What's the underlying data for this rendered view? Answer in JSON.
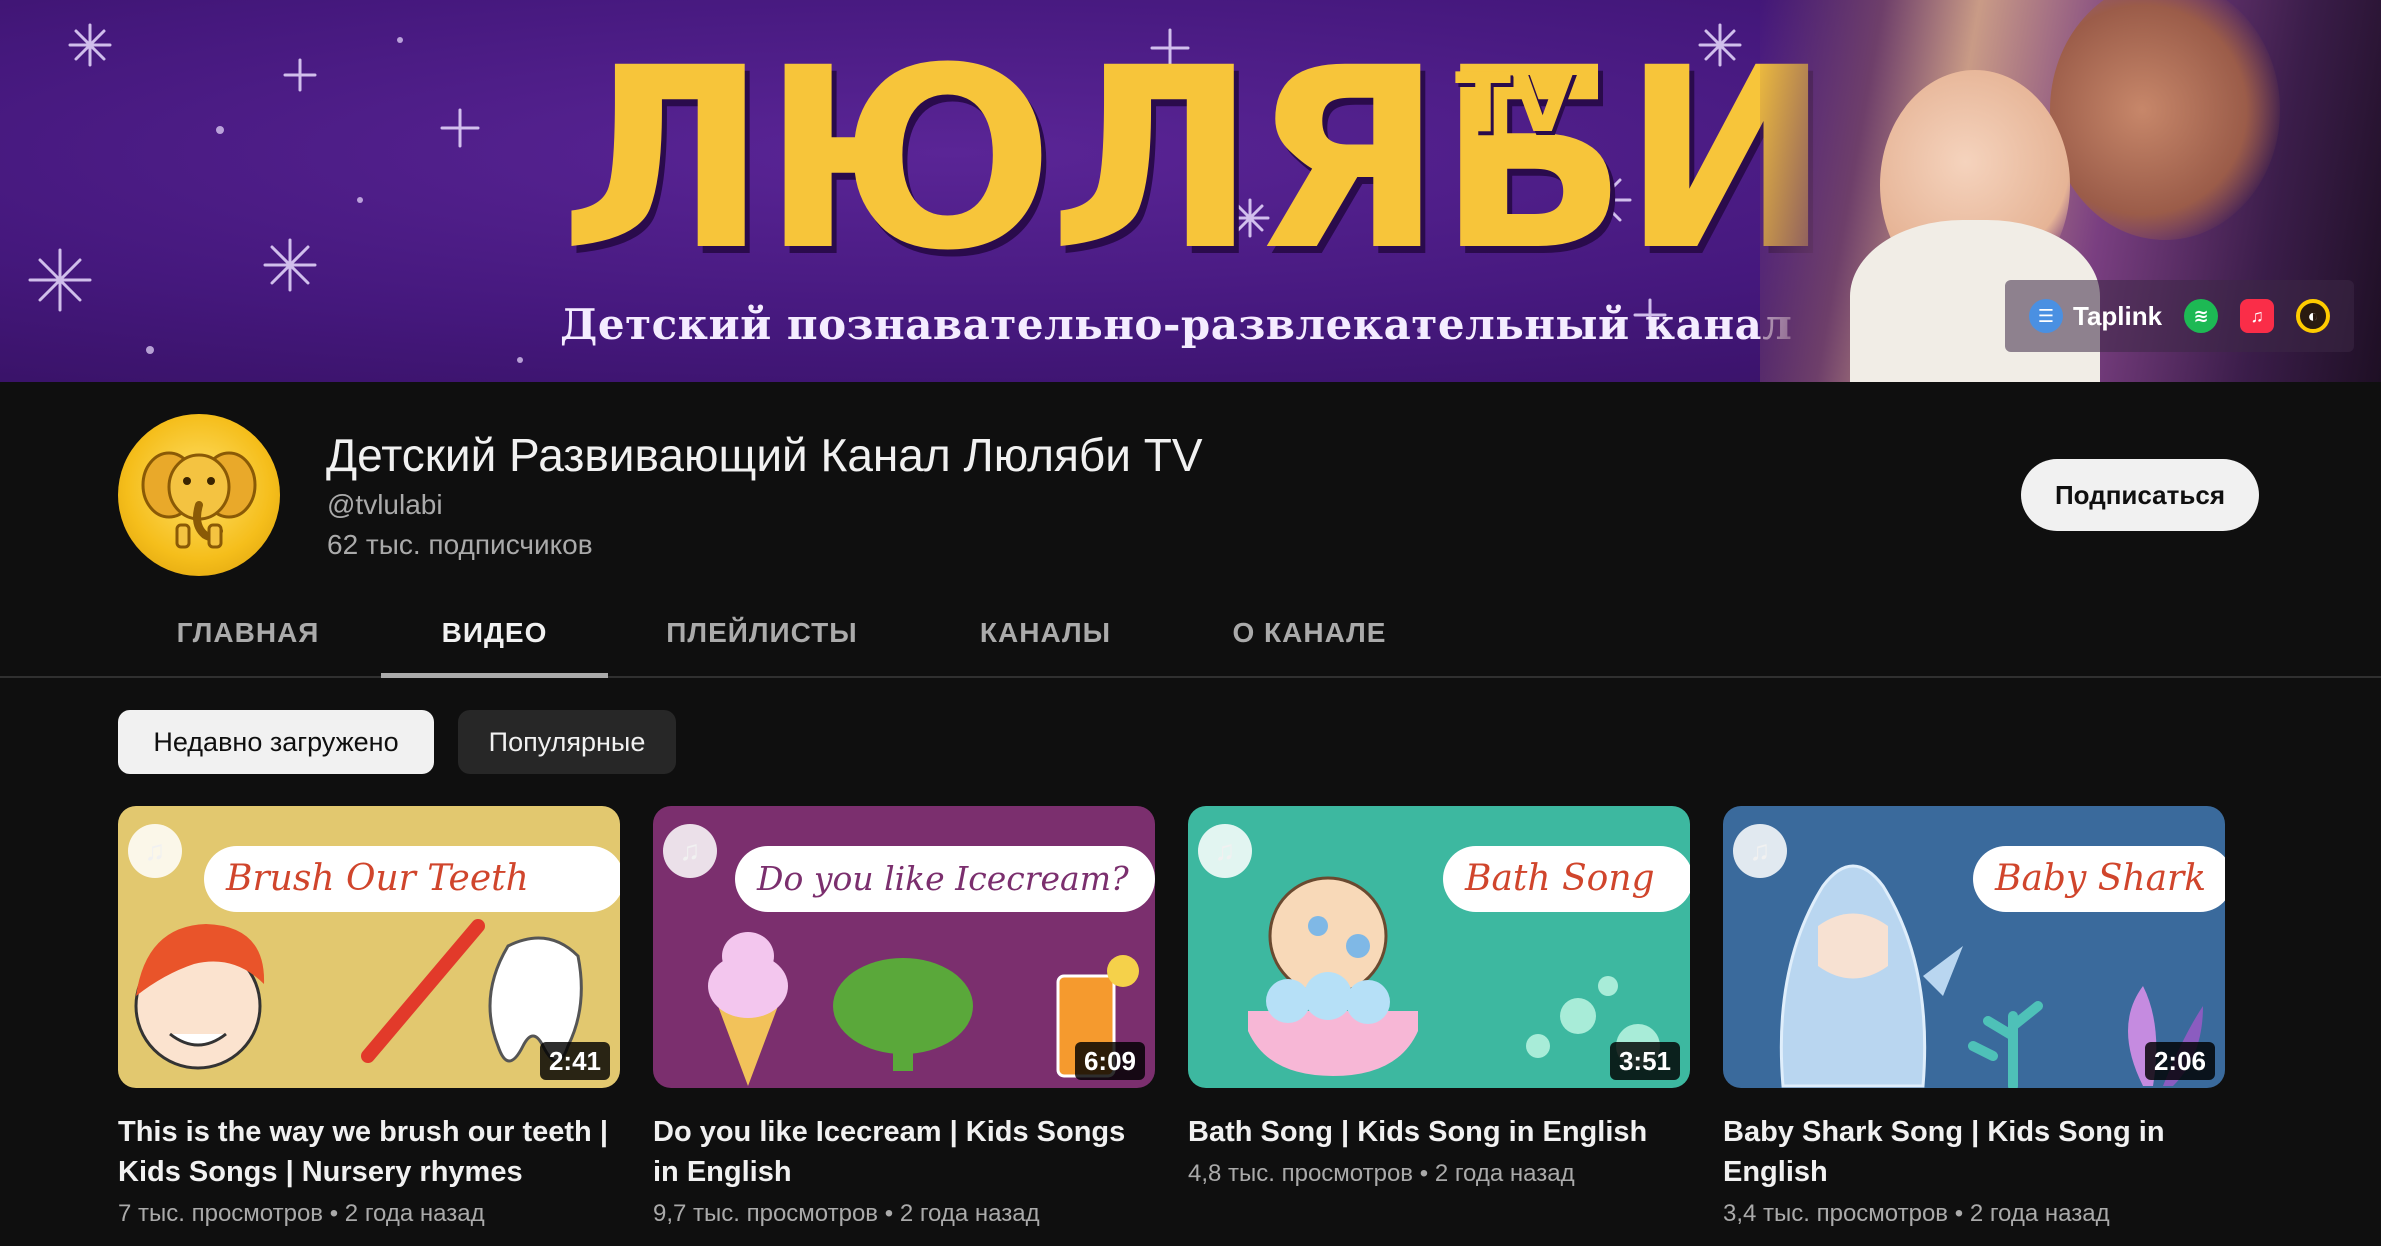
{
  "banner": {
    "logo_text": "ЛЮЛЯБИ",
    "logo_suffix": "TV",
    "tagline": "Детский познавательно-развлекательный канал",
    "links": [
      {
        "label": "Taplink",
        "icon": "taplink-icon",
        "color": "#4a90e2"
      },
      {
        "label": "",
        "icon": "spotify-icon",
        "color": "#1db954"
      },
      {
        "label": "",
        "icon": "apple-music-icon",
        "color": "#fa2d48"
      },
      {
        "label": "",
        "icon": "yandex-music-icon",
        "color": "#ffcc00"
      }
    ]
  },
  "channel": {
    "name": "Детский Развивающий Канал Люляби TV",
    "handle": "@tvlulabi",
    "subscribers": "62 тыс. подписчиков",
    "subscribe_label": "Подписаться"
  },
  "tabs": [
    {
      "label": "ГЛАВНАЯ",
      "active": false
    },
    {
      "label": "ВИДЕО",
      "active": true
    },
    {
      "label": "ПЛЕЙЛИСТЫ",
      "active": false
    },
    {
      "label": "КАНАЛЫ",
      "active": false
    },
    {
      "label": "О КАНАЛЕ",
      "active": false
    }
  ],
  "chips": [
    {
      "label": "Недавно загружено",
      "selected": true
    },
    {
      "label": "Популярные",
      "selected": false
    }
  ],
  "videos": [
    {
      "thumb_text": "Brush Our Teeth",
      "duration": "2:41",
      "title": "This is the way we brush our teeth | Kids Songs | Nursery rhymes",
      "views": "7 тыс. просмотров",
      "age": "2 года назад",
      "bg": "#e2c86f"
    },
    {
      "thumb_text": "Do you like Icecream?",
      "duration": "6:09",
      "title": "Do you like Icecream | Kids Songs in English",
      "views": "9,7 тыс. просмотров",
      "age": "2 года назад",
      "bg": "#7b2f6e"
    },
    {
      "thumb_text": "Bath Song",
      "duration": "3:51",
      "title": "Bath Song | Kids Song in English",
      "views": "4,8 тыс. просмотров",
      "age": "2 года назад",
      "bg": "#3db8a0"
    },
    {
      "thumb_text": "Baby Shark",
      "duration": "2:06",
      "title": "Baby Shark Song | Kids Song in English",
      "views": "3,4 тыс. просмотров",
      "age": "2 года назад",
      "bg": "#3a6a9c"
    }
  ],
  "meta_separator": "•"
}
